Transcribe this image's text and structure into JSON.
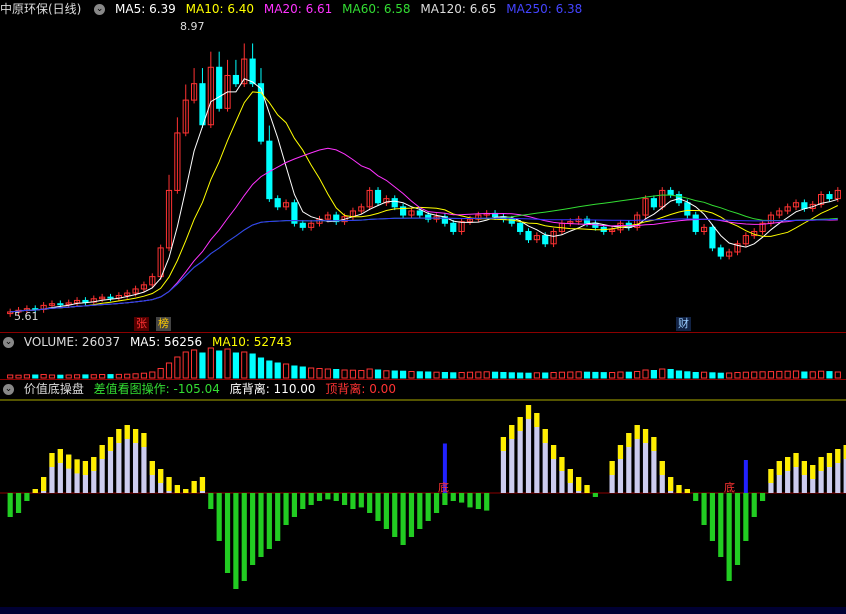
{
  "main": {
    "title": "中原环保(日线)",
    "mas": [
      {
        "label": "MA5: 6.39",
        "color": "#ffffff"
      },
      {
        "label": "MA10: 6.40",
        "color": "#ffff00"
      },
      {
        "label": "MA20: 6.61",
        "color": "#ff33ff"
      },
      {
        "label": "MA60: 6.58",
        "color": "#33dd33"
      },
      {
        "label": "MA120: 6.65",
        "color": "#dddddd"
      },
      {
        "label": "MA250: 6.38",
        "color": "#3333ff"
      }
    ],
    "high_label": "8.97",
    "low_label": "5.61",
    "tags": {
      "zhang": "张",
      "bang": "榜",
      "cai": "财"
    }
  },
  "volume": {
    "title": "VOLUME: 26037",
    "ma5": "MA5: 56256",
    "ma10": "MA10: 52743"
  },
  "indicator": {
    "name": "价值底操盘",
    "p1": "差值看图操作: -105.04",
    "p2": "底背离: 110.00",
    "p3": "顶背离: 0.00",
    "di1": "底",
    "di2": "底"
  },
  "colors": {
    "up": "#ff3333",
    "down": "#00ffff",
    "ma5": "#ffffff",
    "ma10": "#ffff00",
    "ma20": "#ff33ff",
    "ma60": "#33dd33",
    "ma250": "#3333ff"
  },
  "chart_data": [
    {
      "type": "candlestick",
      "title": "中原环保(日线)",
      "ylim": [
        5.4,
        9.2
      ],
      "series": [
        {
          "name": "MA5",
          "last": 6.39
        },
        {
          "name": "MA10",
          "last": 6.4
        },
        {
          "name": "MA20",
          "last": 6.61
        },
        {
          "name": "MA60",
          "last": 6.58
        },
        {
          "name": "MA120",
          "last": 6.65
        },
        {
          "name": "MA250",
          "last": 6.38
        }
      ],
      "close": [
        5.62,
        5.64,
        5.66,
        5.65,
        5.7,
        5.72,
        5.71,
        5.73,
        5.76,
        5.74,
        5.78,
        5.8,
        5.79,
        5.82,
        5.85,
        5.9,
        5.95,
        6.05,
        6.4,
        7.1,
        7.8,
        8.2,
        8.4,
        7.9,
        8.6,
        8.1,
        8.5,
        8.4,
        8.7,
        8.4,
        7.7,
        7.0,
        6.9,
        6.95,
        6.7,
        6.65,
        6.7,
        6.75,
        6.8,
        6.72,
        6.78,
        6.85,
        6.9,
        7.1,
        6.95,
        7.0,
        6.9,
        6.8,
        6.85,
        6.8,
        6.75,
        6.78,
        6.7,
        6.6,
        6.72,
        6.75,
        6.8,
        6.82,
        6.78,
        6.75,
        6.7,
        6.6,
        6.5,
        6.55,
        6.45,
        6.6,
        6.7,
        6.72,
        6.75,
        6.7,
        6.65,
        6.6,
        6.62,
        6.7,
        6.65,
        6.8,
        7.0,
        6.9,
        7.1,
        7.05,
        6.95,
        6.8,
        6.6,
        6.65,
        6.4,
        6.3,
        6.35,
        6.45,
        6.55,
        6.6,
        6.7,
        6.8,
        6.85,
        6.9,
        6.95,
        6.88,
        6.93,
        7.05,
        7.0,
        7.1
      ]
    },
    {
      "type": "bar",
      "title": "VOLUME: 26037",
      "series": [
        {
          "name": "MA5",
          "last": 56256
        },
        {
          "name": "MA10",
          "last": 52743
        }
      ],
      "values": [
        30,
        28,
        32,
        30,
        35,
        30,
        28,
        30,
        32,
        31,
        33,
        35,
        34,
        36,
        38,
        42,
        48,
        60,
        95,
        150,
        210,
        260,
        280,
        250,
        300,
        270,
        290,
        250,
        260,
        240,
        200,
        170,
        150,
        140,
        120,
        110,
        100,
        95,
        90,
        85,
        80,
        78,
        75,
        90,
        80,
        72,
        70,
        68,
        65,
        62,
        60,
        58,
        55,
        52,
        55,
        58,
        60,
        62,
        58,
        55,
        52,
        50,
        48,
        52,
        50,
        55,
        58,
        60,
        62,
        58,
        56,
        54,
        55,
        60,
        58,
        65,
        80,
        75,
        90,
        85,
        70,
        62,
        55,
        58,
        52,
        48,
        50,
        55,
        58,
        60,
        62,
        64,
        66,
        68,
        70,
        60,
        62,
        68,
        64,
        60
      ]
    },
    {
      "type": "bar",
      "title": "价值底操盘",
      "series": [
        {
          "name": "差值看图操作",
          "last": -105.04
        },
        {
          "name": "底背离",
          "last": 110.0
        },
        {
          "name": "顶背离",
          "last": 0.0
        }
      ],
      "values": [
        -30,
        -25,
        -10,
        5,
        20,
        50,
        55,
        48,
        42,
        40,
        45,
        60,
        70,
        80,
        85,
        80,
        75,
        40,
        30,
        20,
        10,
        5,
        15,
        20,
        -20,
        -60,
        -100,
        -120,
        -110,
        -90,
        -80,
        -70,
        -60,
        -40,
        -30,
        -20,
        -15,
        -10,
        -8,
        -10,
        -15,
        -20,
        -18,
        -25,
        -35,
        -45,
        -55,
        -65,
        -55,
        -45,
        -35,
        -25,
        -15,
        -10,
        -12,
        -18,
        -20,
        -22,
        0,
        70,
        85,
        95,
        110,
        100,
        80,
        60,
        45,
        30,
        20,
        10,
        -5,
        0,
        40,
        60,
        75,
        85,
        80,
        70,
        40,
        20,
        10,
        5,
        -10,
        -40,
        -60,
        -80,
        -110,
        -90,
        -60,
        -30,
        -10,
        30,
        40,
        45,
        50,
        40,
        35,
        45,
        50,
        55,
        60
      ]
    }
  ]
}
